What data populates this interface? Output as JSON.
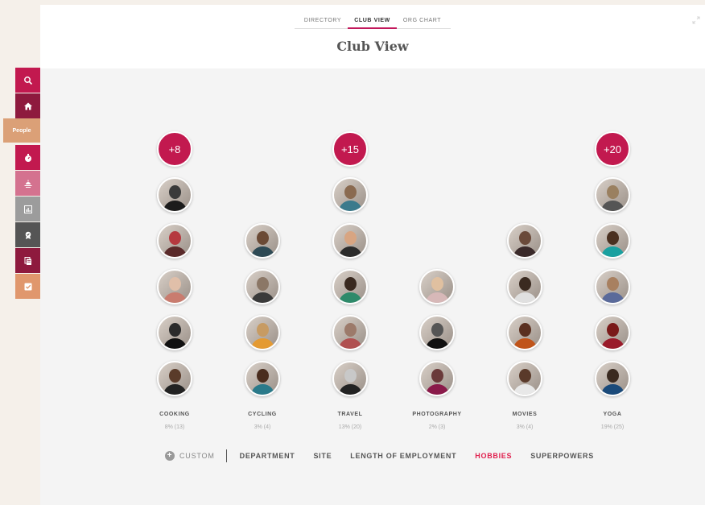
{
  "tabs": [
    {
      "label": "DIRECTORY",
      "active": false
    },
    {
      "label": "CLUB VIEW",
      "active": true
    },
    {
      "label": "ORG CHART",
      "active": false
    }
  ],
  "page_title": "Club View",
  "sidebar": {
    "people_label": "People",
    "items": [
      {
        "icon": "search-icon",
        "color": "#c2194f"
      },
      {
        "icon": "home-icon",
        "color": "#8e1a3e"
      },
      {
        "icon": "stopwatch-icon",
        "color": "#c2194f"
      },
      {
        "icon": "sunset-icon",
        "color": "#d4728f"
      },
      {
        "icon": "report-chart-icon",
        "color": "#9c9c9c"
      },
      {
        "icon": "award-icon",
        "color": "#555555"
      },
      {
        "icon": "documents-icon",
        "color": "#8e1a3e"
      },
      {
        "icon": "checkbox-icon",
        "color": "#e0976d"
      }
    ]
  },
  "clubs": [
    {
      "name": "COOKING",
      "stat": "8% (13)",
      "overflow": "+8",
      "avatars": [
        [
          "#3a3a3a",
          "#1c1c1c"
        ],
        [
          "#b5393f",
          "#5a2a2a"
        ],
        [
          "#e0bfa9",
          "#c97c6f"
        ],
        [
          "#2b2b2b",
          "#111"
        ],
        [
          "#5a3b2a",
          "#222"
        ]
      ]
    },
    {
      "name": "CYCLING",
      "stat": "3% (4)",
      "overflow": "",
      "avatars": [
        null,
        [
          "#6b4a35",
          "#2e4a55"
        ],
        [
          "#8b7766",
          "#3a3a3a"
        ],
        [
          "#c79b63",
          "#e49a32"
        ],
        [
          "#4a2d1e",
          "#2a7a8a"
        ]
      ]
    },
    {
      "name": "TRAVEL",
      "stat": "13% (20)",
      "overflow": "+15",
      "avatars": [
        [
          "#8a6a50",
          "#3b7a8c"
        ],
        [
          "#d8a582",
          "#2b2b2b"
        ],
        [
          "#3a2a20",
          "#2e8a6a"
        ],
        [
          "#9c7a6a",
          "#b05050"
        ],
        [
          "#c8c8c8",
          "#222"
        ]
      ]
    },
    {
      "name": "PHOTOGRAPHY",
      "stat": "2% (3)",
      "overflow": "",
      "avatars": [
        null,
        null,
        [
          "#e0c0a0",
          "#d7b8b8"
        ],
        [
          "#555",
          "#111"
        ],
        [
          "#6a3a3a",
          "#8a1a4a"
        ]
      ]
    },
    {
      "name": "MOVIES",
      "stat": "3% (4)",
      "overflow": "",
      "avatars": [
        null,
        [
          "#6a4a3a",
          "#3a2a2a"
        ],
        [
          "#3a2a20",
          "#e0e0e0"
        ],
        [
          "#5a3020",
          "#c0541a"
        ],
        [
          "#5a3a2a",
          "#e8e8e8"
        ]
      ]
    },
    {
      "name": "YOGA",
      "stat": "19% (25)",
      "overflow": "+20",
      "avatars": [
        [
          "#9a8060",
          "#555"
        ],
        [
          "#4a3020",
          "#1aa0a0"
        ],
        [
          "#a88060",
          "#5a6a9a"
        ],
        [
          "#7a1a1a",
          "#9a1a2a"
        ],
        [
          "#3a2a20",
          "#1a4a7a"
        ]
      ]
    }
  ],
  "filters": {
    "custom_label": "CUSTOM",
    "items": [
      {
        "label": "DEPARTMENT",
        "active": false
      },
      {
        "label": "SITE",
        "active": false
      },
      {
        "label": "LENGTH OF EMPLOYMENT",
        "active": false
      },
      {
        "label": "HOBBIES",
        "active": true
      },
      {
        "label": "SUPERPOWERS",
        "active": false
      }
    ]
  }
}
